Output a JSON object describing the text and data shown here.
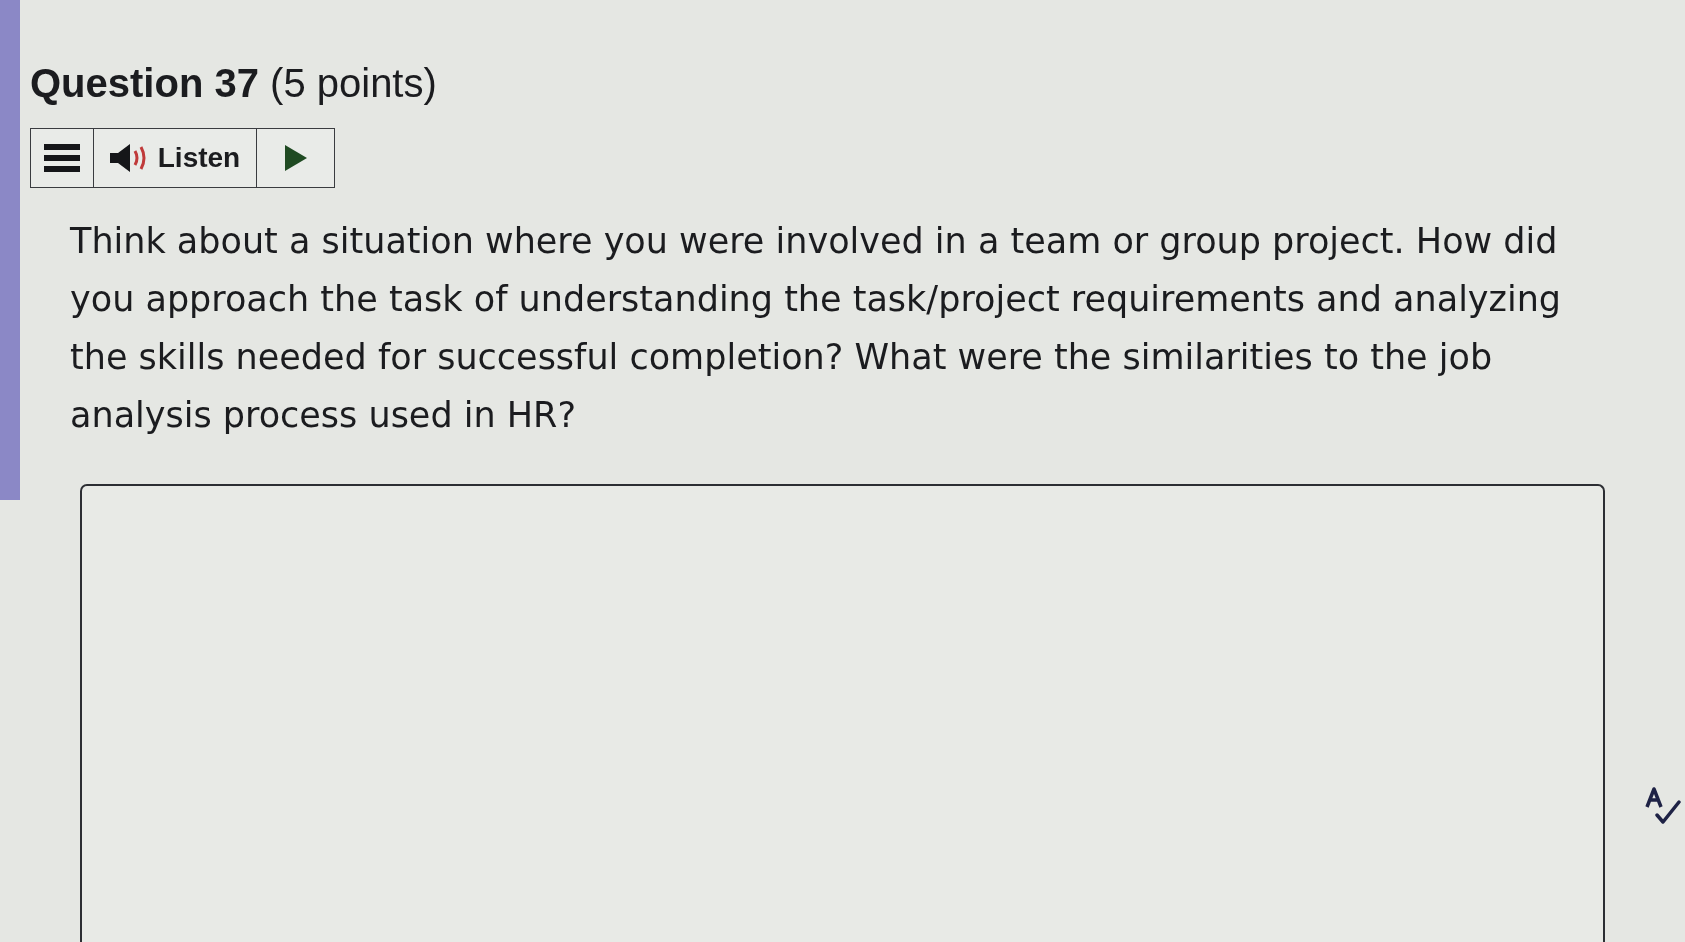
{
  "question": {
    "title": "**Question 37** (5 points)",
    "toolbar": {
      "listen_label": "Listen"
    },
    "prompt": "Think about a situation where you were involved in a team or group project. How did you approach the task of understanding the task/project requirements and analyzing the skills needed for successful completion? What were the similarities to the job analysis process used in HR?"
  }
}
